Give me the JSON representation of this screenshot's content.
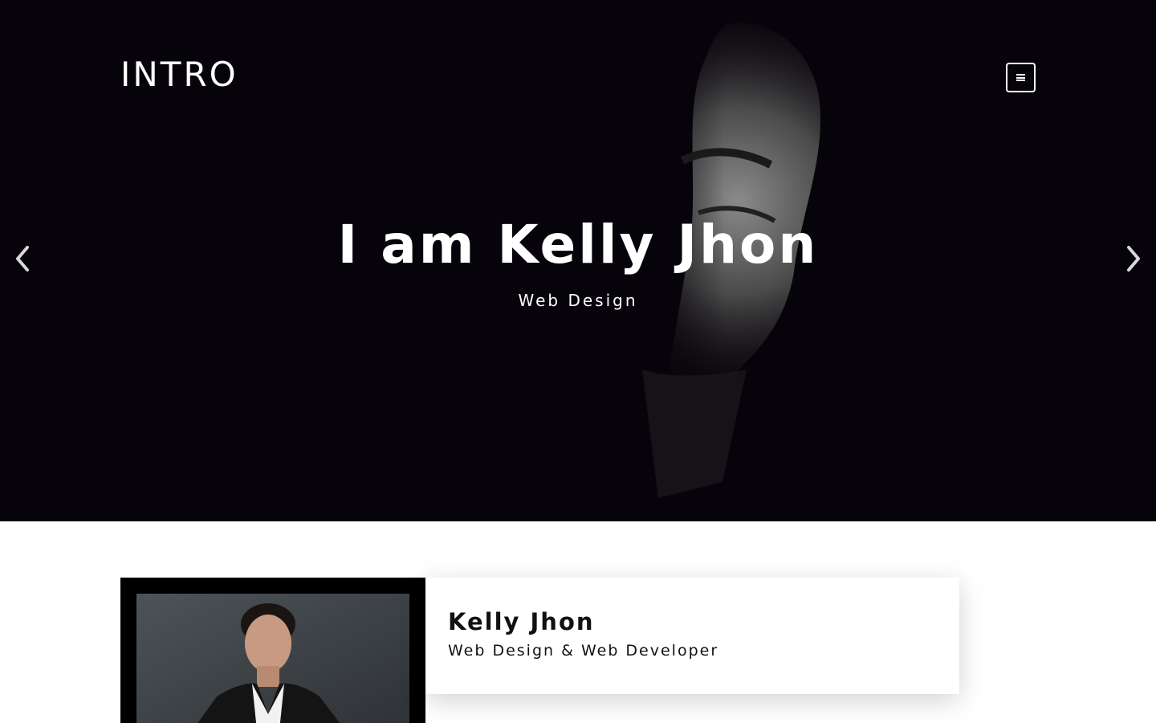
{
  "header": {
    "brand": "INTRO",
    "menu_icon": "hamburger-menu-icon"
  },
  "hero": {
    "title": "I am Kelly Jhon",
    "subtitle": "Web Design",
    "prev_icon": "chevron-left-icon",
    "next_icon": "chevron-right-icon"
  },
  "about": {
    "name": "Kelly Jhon",
    "role": "Web Design & Web Developer"
  },
  "colors": {
    "hero_bg": "#07030a",
    "text_light": "#ffffff",
    "text_dark": "#111111",
    "frame": "#000000"
  }
}
